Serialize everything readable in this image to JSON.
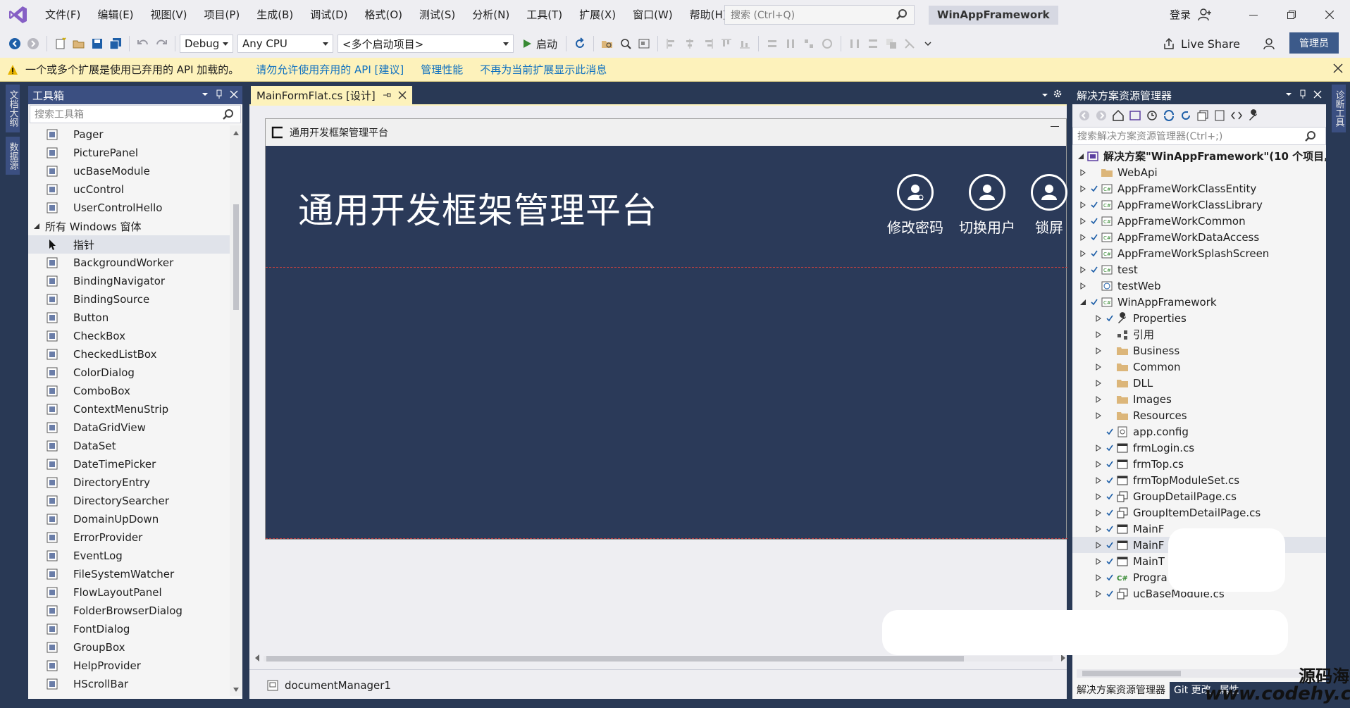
{
  "titlebar": {
    "menu": [
      "文件(F)",
      "编辑(E)",
      "视图(V)",
      "项目(P)",
      "生成(B)",
      "调试(D)",
      "格式(O)",
      "测试(S)",
      "分析(N)",
      "工具(T)",
      "扩展(X)",
      "窗口(W)",
      "帮助(H)"
    ],
    "search_placeholder": "搜索 (Ctrl+Q)",
    "solution_name": "WinAppFramework",
    "signin": "登录"
  },
  "toolbar": {
    "config": "Debug",
    "platform": "Any CPU",
    "startup": "<多个启动项目>",
    "run_label": "启动",
    "liveshare": "Live Share",
    "admin": "管理员"
  },
  "infobar": {
    "message": "一个或多个扩展是使用已弃用的 API 加载的。",
    "links": [
      "请勿允许使用弃用的 API [建议]",
      "管理性能",
      "不再为当前扩展显示此消息"
    ]
  },
  "leftstrip": {
    "tabs": [
      "文档大纲",
      "数据源"
    ]
  },
  "rightstrip": {
    "tabs": [
      "诊断工具"
    ]
  },
  "toolbox": {
    "title": "工具箱",
    "search_placeholder": "搜索工具箱",
    "items_top": [
      "Pager",
      "PicturePanel",
      "ucBaseModule",
      "ucControl",
      "UserControlHello"
    ],
    "group": "所有 Windows 窗体",
    "pointer": "指针",
    "items": [
      "BackgroundWorker",
      "BindingNavigator",
      "BindingSource",
      "Button",
      "CheckBox",
      "CheckedListBox",
      "ColorDialog",
      "ComboBox",
      "ContextMenuStrip",
      "DataGridView",
      "DataSet",
      "DateTimePicker",
      "DirectoryEntry",
      "DirectorySearcher",
      "DomainUpDown",
      "ErrorProvider",
      "EventLog",
      "FileSystemWatcher",
      "FlowLayoutPanel",
      "FolderBrowserDialog",
      "FontDialog",
      "GroupBox",
      "HelpProvider",
      "HScrollBar"
    ]
  },
  "document": {
    "tab_label": "MainFormFlat.cs [设计]",
    "form_title": "通用开发框架管理平台",
    "heading": "通用开发框架管理平台",
    "actions": [
      "修改密码",
      "切换用户",
      "锁屏"
    ],
    "component": "documentManager1"
  },
  "solution_explorer": {
    "title": "解决方案资源管理器",
    "search_placeholder": "搜索解决方案资源管理器(Ctrl+;)",
    "root": "解决方案\"WinAppFramework\"(10 个项目,",
    "nodes": [
      {
        "label": "WebApi",
        "depth": 1,
        "icon": "folder-icon",
        "check": false,
        "expand": true
      },
      {
        "label": "AppFrameWorkClassEntity",
        "depth": 1,
        "icon": "csproj-icon",
        "check": true,
        "expand": true
      },
      {
        "label": "AppFrameWorkClassLibrary",
        "depth": 1,
        "icon": "csproj-icon",
        "check": true,
        "expand": true
      },
      {
        "label": "AppFrameWorkCommon",
        "depth": 1,
        "icon": "csproj-icon",
        "check": true,
        "expand": true
      },
      {
        "label": "AppFrameWorkDataAccess",
        "depth": 1,
        "icon": "csproj-icon",
        "check": true,
        "expand": true
      },
      {
        "label": "AppFrameWorkSplashScreen",
        "depth": 1,
        "icon": "csproj-icon",
        "check": true,
        "expand": true
      },
      {
        "label": "test",
        "depth": 1,
        "icon": "csproj-icon",
        "check": true,
        "expand": true
      },
      {
        "label": "testWeb",
        "depth": 1,
        "icon": "webproj-icon",
        "check": false,
        "expand": true
      },
      {
        "label": "WinAppFramework",
        "depth": 1,
        "icon": "csproj-icon",
        "check": true,
        "expand": "open"
      },
      {
        "label": "Properties",
        "depth": 2,
        "icon": "wrench-icon",
        "check": true,
        "expand": true
      },
      {
        "label": "引用",
        "depth": 2,
        "icon": "references-icon",
        "check": false,
        "expand": true
      },
      {
        "label": "Business",
        "depth": 2,
        "icon": "folder-icon",
        "check": false,
        "expand": true
      },
      {
        "label": "Common",
        "depth": 2,
        "icon": "folder-icon",
        "check": false,
        "expand": true
      },
      {
        "label": "DLL",
        "depth": 2,
        "icon": "folder-icon",
        "check": false,
        "expand": true
      },
      {
        "label": "Images",
        "depth": 2,
        "icon": "folder-icon",
        "check": false,
        "expand": true
      },
      {
        "label": "Resources",
        "depth": 2,
        "icon": "folder-icon",
        "check": false,
        "expand": true
      },
      {
        "label": "app.config",
        "depth": 2,
        "icon": "config-icon",
        "check": true,
        "expand": false
      },
      {
        "label": "frmLogin.cs",
        "depth": 2,
        "icon": "form-icon",
        "check": true,
        "expand": true
      },
      {
        "label": "frmTop.cs",
        "depth": 2,
        "icon": "form-icon",
        "check": true,
        "expand": true
      },
      {
        "label": "frmTopModuleSet.cs",
        "depth": 2,
        "icon": "form-icon",
        "check": true,
        "expand": true
      },
      {
        "label": "GroupDetailPage.cs",
        "depth": 2,
        "icon": "usercontrol-icon",
        "check": true,
        "expand": true
      },
      {
        "label": "GroupItemDetailPage.cs",
        "depth": 2,
        "icon": "usercontrol-icon",
        "check": true,
        "expand": true
      },
      {
        "label": "MainF",
        "depth": 2,
        "icon": "form-icon",
        "check": true,
        "expand": true
      },
      {
        "label": "MainF",
        "depth": 2,
        "icon": "form-icon",
        "check": true,
        "expand": true
      },
      {
        "label": "MainT",
        "depth": 2,
        "icon": "form-icon",
        "check": true,
        "expand": true
      },
      {
        "label": "Progra",
        "depth": 2,
        "icon": "csfile-icon",
        "check": true,
        "expand": true
      },
      {
        "label": "ucBaseModule.cs",
        "depth": 2,
        "icon": "usercontrol-icon",
        "check": true,
        "expand": true
      }
    ],
    "bottom_tabs": [
      "解决方案资源管理器",
      "Git 更改",
      "属性"
    ]
  },
  "watermark": {
    "line1": "源码海洋网",
    "line2": "www.codehy.com"
  },
  "colors": {
    "accent": "#293955",
    "panel_head": "#3b4f81",
    "form_bg": "#2b3a59",
    "infobar": "#fdf2bb",
    "link": "#0e70c0"
  }
}
